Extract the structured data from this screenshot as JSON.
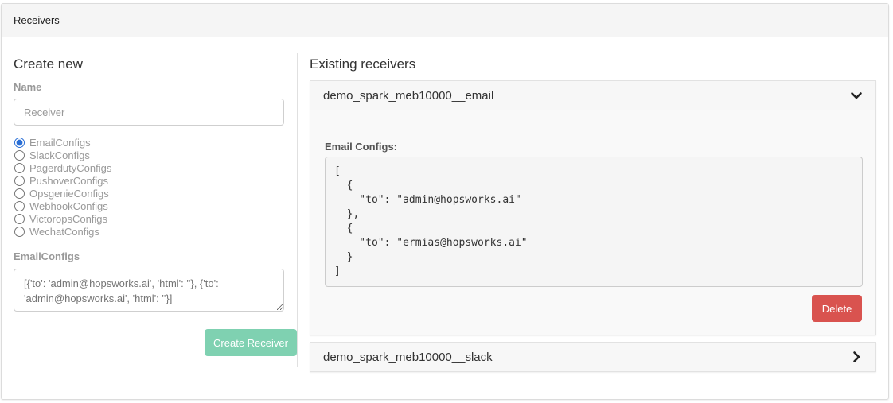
{
  "header": {
    "title": "Receivers"
  },
  "create": {
    "title": "Create new",
    "name_label": "Name",
    "name_placeholder": "Receiver",
    "config_types": [
      {
        "label": "EmailConfigs",
        "selected": true
      },
      {
        "label": "SlackConfigs",
        "selected": false
      },
      {
        "label": "PagerdutyConfigs",
        "selected": false
      },
      {
        "label": "PushoverConfigs",
        "selected": false
      },
      {
        "label": "OpsgenieConfigs",
        "selected": false
      },
      {
        "label": "WebhookConfigs",
        "selected": false
      },
      {
        "label": "VictoropsConfigs",
        "selected": false
      },
      {
        "label": "WechatConfigs",
        "selected": false
      }
    ],
    "configs_label": "EmailConfigs",
    "configs_placeholder": "[{'to': 'admin@hopsworks.ai', 'html': ''}, {'to': 'admin@hopsworks.ai', 'html': ''}]",
    "submit_label": "Create Receiver"
  },
  "existing": {
    "title": "Existing receivers",
    "receivers": [
      {
        "name": "demo_spark_meb10000__email",
        "expanded": true,
        "configs_label": "Email Configs:",
        "config_lines": [
          "[",
          "  {",
          "    \"to\": \"admin@hopsworks.ai\"",
          "  },",
          "  {",
          "    \"to\": \"ermias@hopsworks.ai\"",
          "  }",
          "]"
        ],
        "delete_label": "Delete"
      },
      {
        "name": "demo_spark_meb10000__slack",
        "expanded": false
      }
    ]
  },
  "colors": {
    "create_button": "#7fd1b1",
    "delete_button": "#d9534f",
    "radio_accent": "#2a6fd6"
  },
  "icons": {
    "expanded": "chevron-down-icon",
    "collapsed": "chevron-right-icon"
  }
}
